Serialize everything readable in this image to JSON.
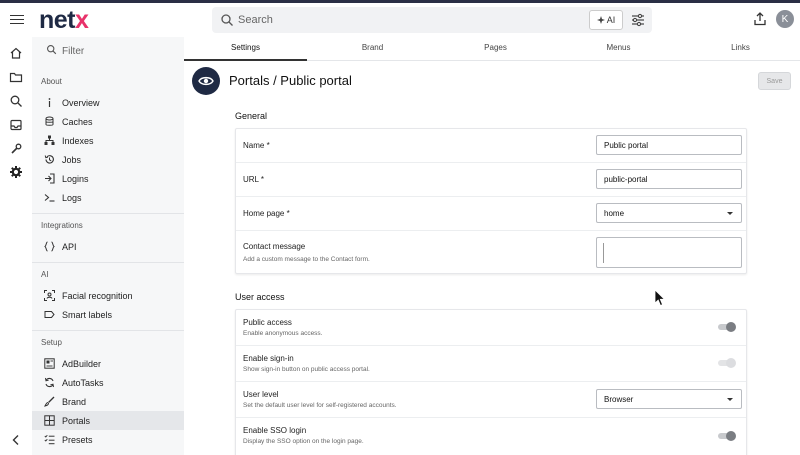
{
  "header": {
    "logo_prefix": "net",
    "logo_suffix": "x",
    "search_placeholder": "Search",
    "ai_label": "AI",
    "avatar_initial": "K"
  },
  "sidebar": {
    "filter_placeholder": "Filter",
    "sections": [
      {
        "heading": "About",
        "items": [
          "Overview",
          "Caches",
          "Indexes",
          "Jobs",
          "Logins",
          "Logs"
        ]
      },
      {
        "heading": "Integrations",
        "items": [
          "API"
        ]
      },
      {
        "heading": "AI",
        "items": [
          "Facial recognition",
          "Smart labels"
        ]
      },
      {
        "heading": "Setup",
        "items": [
          "AdBuilder",
          "AutoTasks",
          "Brand",
          "Portals",
          "Presets"
        ]
      }
    ],
    "active_item": "Portals"
  },
  "tabs": [
    "Settings",
    "Brand",
    "Pages",
    "Menus",
    "Links"
  ],
  "active_tab": "Settings",
  "page": {
    "title": "Portals / Public portal",
    "save_label": "Save"
  },
  "general": {
    "title": "General",
    "name_label": "Name *",
    "name_value": "Public portal",
    "url_label": "URL *",
    "url_value": "public-portal",
    "home_label": "Home page *",
    "home_value": "home",
    "contact_label": "Contact message",
    "contact_desc": "Add a custom message to the Contact form."
  },
  "user_access": {
    "title": "User access",
    "public_label": "Public access",
    "public_desc": "Enable anonymous access.",
    "signin_label": "Enable sign-in",
    "signin_desc": "Show sign-in button on public access portal.",
    "level_label": "User level",
    "level_desc": "Set the default user level for self-registered accounts.",
    "level_value": "Browser",
    "sso_label": "Enable SSO login",
    "sso_desc": "Display the SSO option on the login page."
  },
  "colors": {
    "brand_dark": "#1f2a44",
    "brand_accent": "#e8326a",
    "active_bg": "#e5e7ea"
  },
  "icons": {
    "rail": [
      "home-icon",
      "folder-icon",
      "search-icon",
      "inbox-icon",
      "tools-icon",
      "gear-icon"
    ],
    "page": "eye-icon"
  }
}
